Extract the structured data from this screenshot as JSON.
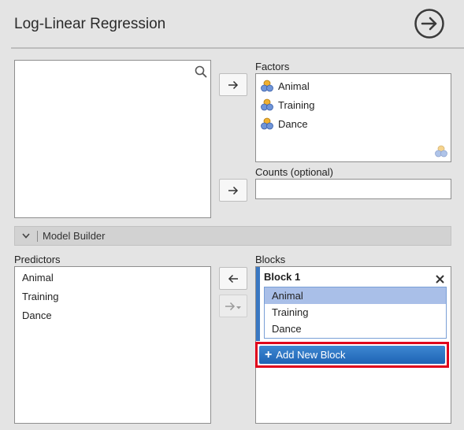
{
  "header": {
    "title": "Log-Linear Regression",
    "go_icon": "arrow-circle-right-icon"
  },
  "source_list": {
    "search_icon": "search-icon",
    "items": []
  },
  "factors": {
    "label": "Factors",
    "items": [
      "Animal",
      "Training",
      "Dance"
    ],
    "item_icon": "nominal-variable-icon",
    "footer_icon": "nominal-variable-icon"
  },
  "counts": {
    "label": "Counts (optional)",
    "value": ""
  },
  "buttons": {
    "move_right_icon": "arrow-right-icon",
    "move_left_icon": "arrow-left-icon",
    "move_right_dropdown_icon": "arrow-right-dropdown-icon"
  },
  "model_builder": {
    "label": "Model Builder",
    "toggle_icon": "chevron-down-icon"
  },
  "predictors": {
    "label": "Predictors",
    "items": [
      "Animal",
      "Training",
      "Dance"
    ]
  },
  "blocks": {
    "label": "Blocks",
    "block1": {
      "title": "Block 1",
      "items": [
        "Animal",
        "Training",
        "Dance"
      ],
      "selected_item": "Animal",
      "close_icon": "close-icon"
    },
    "add_button_label": "Add New Block",
    "add_button_icon": "plus-icon"
  },
  "colors": {
    "accent_blue": "#1e63b4",
    "selection": "#a9bfe8",
    "highlight_red": "#e0001b",
    "block_bar": "#3a78c2"
  }
}
